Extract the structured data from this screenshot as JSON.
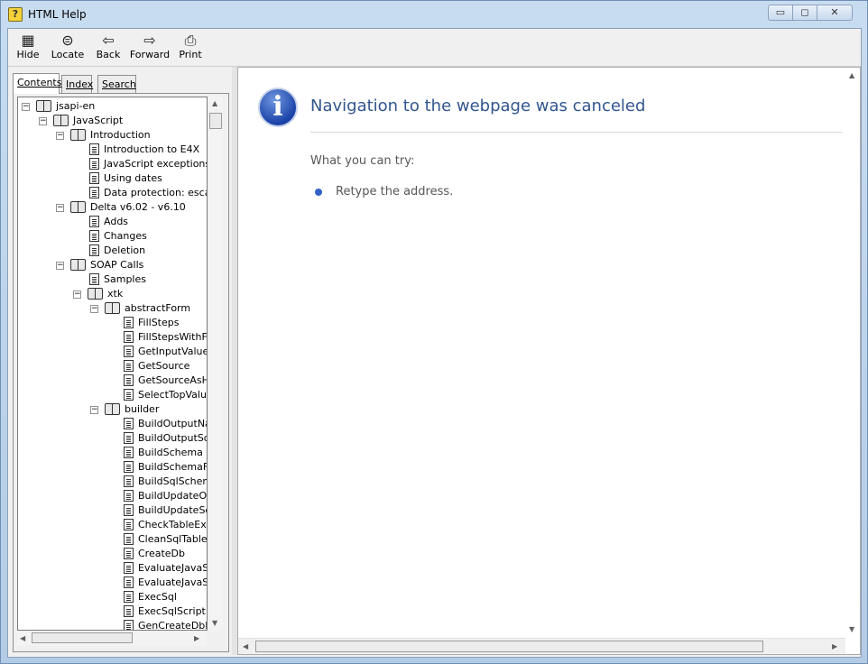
{
  "window": {
    "title": "HTML Help"
  },
  "titlebar_buttons": {
    "minimize": "▭",
    "maximize": "◻",
    "close": "✕"
  },
  "toolbar": {
    "hide": "Hide",
    "locate": "Locate",
    "back": "Back",
    "forward": "Forward",
    "print": "Print"
  },
  "tabs": {
    "contents": "Contents",
    "index": "Index",
    "search": "Search"
  },
  "tree": [
    {
      "label": "jsapi-en",
      "type": "book",
      "level": 0,
      "expanded": true
    },
    {
      "label": "JavaScript",
      "type": "book",
      "level": 1,
      "expanded": true
    },
    {
      "label": "Introduction",
      "type": "book",
      "level": 2,
      "expanded": true
    },
    {
      "label": "Introduction to E4X",
      "type": "page",
      "level": 3
    },
    {
      "label": "JavaScript exceptions",
      "type": "page",
      "level": 3
    },
    {
      "label": "Using dates",
      "type": "page",
      "level": 3
    },
    {
      "label": "Data protection: escapi",
      "type": "page",
      "level": 3
    },
    {
      "label": "Delta v6.02 - v6.10",
      "type": "book",
      "level": 2,
      "expanded": true
    },
    {
      "label": "Adds",
      "type": "page",
      "level": 3
    },
    {
      "label": "Changes",
      "type": "page",
      "level": 3
    },
    {
      "label": "Deletion",
      "type": "page",
      "level": 3
    },
    {
      "label": "SOAP Calls",
      "type": "book",
      "level": 2,
      "expanded": true
    },
    {
      "label": "Samples",
      "type": "page",
      "level": 3
    },
    {
      "label": "xtk",
      "type": "book",
      "level": 3,
      "expanded": true
    },
    {
      "label": "abstractForm",
      "type": "book",
      "level": 4,
      "expanded": true
    },
    {
      "label": "FillSteps",
      "type": "page",
      "level": 5
    },
    {
      "label": "FillStepsWithFil",
      "type": "page",
      "level": 5
    },
    {
      "label": "GetInputValues",
      "type": "page",
      "level": 5
    },
    {
      "label": "GetSource",
      "type": "page",
      "level": 5
    },
    {
      "label": "GetSourceAsHt",
      "type": "page",
      "level": 5
    },
    {
      "label": "SelectTopValue",
      "type": "page",
      "level": 5
    },
    {
      "label": "builder",
      "type": "book",
      "level": 4,
      "expanded": true
    },
    {
      "label": "BuildOutputNav",
      "type": "page",
      "level": 5
    },
    {
      "label": "BuildOutputSch",
      "type": "page",
      "level": 5
    },
    {
      "label": "BuildSchema",
      "type": "page",
      "level": 5
    },
    {
      "label": "BuildSchemaFr",
      "type": "page",
      "level": 5
    },
    {
      "label": "BuildSqlSchem",
      "type": "page",
      "level": 5
    },
    {
      "label": "BuildUpdateOn",
      "type": "page",
      "level": 5
    },
    {
      "label": "BuildUpdateSc",
      "type": "page",
      "level": 5
    },
    {
      "label": "CheckTableExi",
      "type": "page",
      "level": 5
    },
    {
      "label": "CleanSqlTable",
      "type": "page",
      "level": 5
    },
    {
      "label": "CreateDb",
      "type": "page",
      "level": 5
    },
    {
      "label": "EvaluateJavaS",
      "type": "page",
      "level": 5
    },
    {
      "label": "EvaluateJavaS",
      "type": "page",
      "level": 5
    },
    {
      "label": "ExecSql",
      "type": "page",
      "level": 5
    },
    {
      "label": "ExecSqlScript",
      "type": "page",
      "level": 5
    },
    {
      "label": "GenCreateDbD",
      "type": "page",
      "level": 5
    }
  ],
  "content": {
    "heading": "Navigation to the webpage was canceled",
    "try_label": "What you can try:",
    "suggestion": "Retype the address."
  },
  "colors": {
    "heading": "#31558f",
    "bullet": "#3262c8",
    "info_icon": "#1c43a8"
  }
}
